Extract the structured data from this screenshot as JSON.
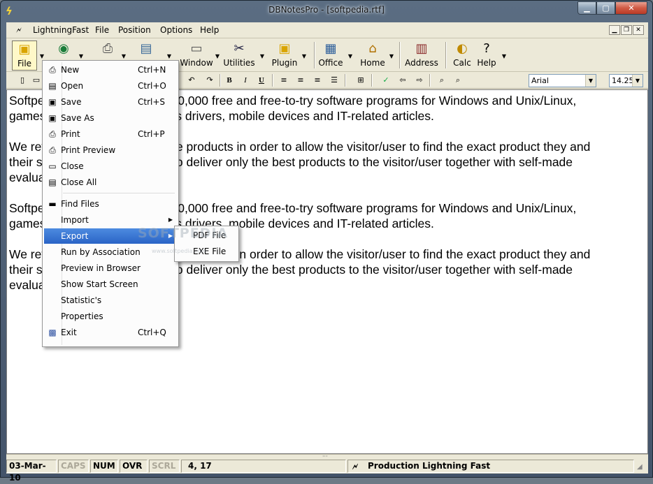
{
  "window": {
    "title": "DBNotesPro - [softpedia.rtf]",
    "min_glyph": "▁",
    "max_glyph": "▢",
    "close_glyph": "✕"
  },
  "menubar": {
    "items": [
      "LightningFast",
      "File",
      "Position",
      "Options",
      "Help"
    ],
    "mdi_min": "▁",
    "mdi_restore": "❐",
    "mdi_close": "✕"
  },
  "toolbar": {
    "buttons": [
      {
        "label": "File",
        "icon": "folder-icon"
      },
      {
        "label": "",
        "icon": "web-globe-icon"
      },
      {
        "label": "",
        "icon": "print-icon"
      },
      {
        "label": "",
        "icon": "document-icon"
      },
      {
        "label": "Window",
        "icon": "window-icon"
      },
      {
        "label": "Utilities",
        "icon": "scissors-icon"
      },
      {
        "label": "Plugin",
        "icon": "plugin-folder-icon"
      },
      {
        "label": "Office",
        "icon": "office-icon"
      },
      {
        "label": "Home",
        "icon": "home-icon"
      },
      {
        "label": "Address",
        "icon": "address-book-icon"
      },
      {
        "label": "Calc",
        "icon": "calc-icon"
      },
      {
        "label": "Help",
        "icon": "help-icon"
      }
    ]
  },
  "format_toolbar": {
    "bold": "B",
    "italic": "I",
    "underline": "U",
    "font": "Arial",
    "size": "14.25"
  },
  "editor": {
    "paragraphs": [
      "Softpedia is a library of over 400,000 free and free-to-try software programs for Windows and Unix/Linux,\ngames, Mac software, Windows drivers, mobile devices and IT-related articles.",
      "We review and categorize these products in order to allow the visitor/user to find the exact product they and\ntheir system needs. We strive to deliver only the best products to the visitor/user together with self-made\nevaluation and review notes.",
      "Softpedia is a library of over 400,000 free and free-to-try software programs for Windows and Unix/Linux,\ngames, Mac software, Windows drivers, mobile devices and IT-related articles.",
      "We review and categorize these products in order to allow the visitor/user to find the exact product they and\ntheir system needs. We strive to deliver only the best products to the visitor/user together with self-made\nevaluation and review notes."
    ],
    "scroll_grip": "···"
  },
  "file_menu": {
    "items": [
      {
        "label": "New",
        "shortcut": "Ctrl+N",
        "icon": "new-icon"
      },
      {
        "label": "Open",
        "shortcut": "Ctrl+O",
        "icon": "open-icon"
      },
      {
        "label": "Save",
        "shortcut": "Ctrl+S",
        "icon": "save-icon"
      },
      {
        "label": "Save As",
        "shortcut": "",
        "icon": "save-as-icon"
      },
      {
        "label": "Print",
        "shortcut": "Ctrl+P",
        "icon": "print-icon"
      },
      {
        "label": "Print Preview",
        "shortcut": "",
        "icon": "print-preview-icon"
      },
      {
        "label": "Close",
        "shortcut": "",
        "icon": "close-doc-icon"
      },
      {
        "label": "Close All",
        "shortcut": "",
        "icon": "close-all-icon"
      },
      {
        "label": "Find Files",
        "shortcut": "",
        "icon": "find-files-icon"
      },
      {
        "label": "Import",
        "shortcut": "",
        "icon": ""
      },
      {
        "label": "Export",
        "shortcut": "",
        "icon": ""
      },
      {
        "label": "Run by Association",
        "shortcut": "",
        "icon": ""
      },
      {
        "label": "Preview in Browser",
        "shortcut": "",
        "icon": ""
      },
      {
        "label": "Show Start Screen",
        "shortcut": "",
        "icon": ""
      },
      {
        "label": "Statistic's",
        "shortcut": "",
        "icon": ""
      },
      {
        "label": "Properties",
        "shortcut": "",
        "icon": ""
      },
      {
        "label": "Exit",
        "shortcut": "Ctrl+Q",
        "icon": "exit-icon"
      }
    ],
    "submenu_arrow": "▶"
  },
  "export_submenu": {
    "items": [
      "PDF File",
      "EXE File"
    ]
  },
  "statusbar": {
    "date": "03-Mar-10",
    "caps": "CAPS",
    "num": "NUM",
    "ovr": "OVR",
    "scrl": "SCRL",
    "position": "4, 17",
    "message": "Production Lightning Fast"
  },
  "watermark": {
    "text": "SOFTPEDIA",
    "url": "www.softpedia.com"
  }
}
